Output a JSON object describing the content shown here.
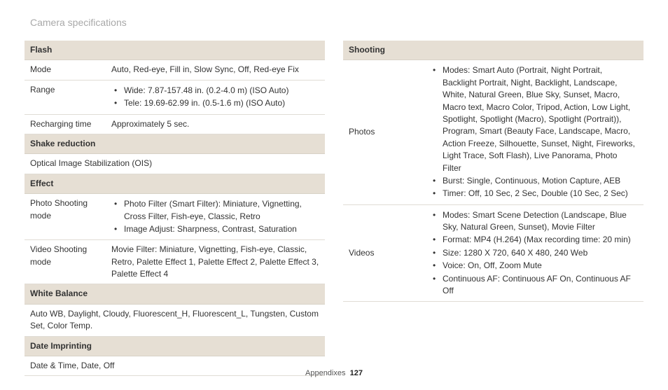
{
  "page_title": "Camera specifications",
  "footer_label": "Appendixes",
  "footer_page": "127",
  "left": {
    "flash": {
      "header": "Flash",
      "rows": {
        "mode_label": "Mode",
        "mode_value": "Auto, Red-eye, Fill in, Slow Sync, Off, Red-eye Fix",
        "range_label": "Range",
        "range_bullets": [
          "Wide: 7.87-157.48 in. (0.2-4.0 m) (ISO Auto)",
          "Tele: 19.69-62.99 in. (0.5-1.6 m) (ISO Auto)"
        ],
        "recharge_label": "Recharging time",
        "recharge_value": "Approximately 5 sec."
      }
    },
    "shake": {
      "header": "Shake reduction",
      "value": "Optical Image Stabilization (OIS)"
    },
    "effect": {
      "header": "Effect",
      "photo_label": "Photo Shooting mode",
      "photo_bullets": [
        "Photo Filter (Smart Filter): Miniature, Vignetting, Cross Filter, Fish-eye, Classic, Retro",
        "Image Adjust: Sharpness, Contrast, Saturation"
      ],
      "video_label": "Video Shooting mode",
      "video_value": "Movie Filter: Miniature, Vignetting, Fish-eye, Classic, Retro, Palette Effect 1, Palette Effect 2, Palette Effect 3, Palette Effect 4"
    },
    "wb": {
      "header": "White Balance",
      "value": "Auto WB, Daylight, Cloudy, Fluorescent_H, Fluorescent_L, Tungsten, Custom Set, Color Temp."
    },
    "date": {
      "header": "Date Imprinting",
      "value": "Date & Time, Date, Off"
    }
  },
  "right": {
    "shooting": {
      "header": "Shooting",
      "photos_label": "Photos",
      "photos_bullets": [
        "Modes: Smart Auto (Portrait, Night Portrait, Backlight Portrait, Night, Backlight, Landscape, White, Natural Green, Blue Sky, Sunset, Macro, Macro text, Macro Color, Tripod, Action, Low Light, Spotlight, Spotlight (Macro), Spotlight (Portrait)), Program, Smart (Beauty Face, Landscape, Macro, Action Freeze, Silhouette, Sunset, Night, Fireworks, Light Trace, Soft Flash), Live Panorama, Photo Filter",
        "Burst: Single, Continuous, Motion Capture, AEB",
        "Timer: Off, 10 Sec, 2 Sec, Double (10 Sec, 2 Sec)"
      ],
      "videos_label": "Videos",
      "videos_bullets": [
        "Modes: Smart Scene Detection (Landscape, Blue Sky, Natural Green, Sunset), Movie Filter",
        "Format: MP4 (H.264) (Max recording time: 20 min)",
        "Size: 1280 X 720, 640 X 480, 240 Web",
        "Voice: On, Off, Zoom Mute",
        "Continuous AF: Continuous AF On, Continuous AF Off"
      ]
    }
  }
}
